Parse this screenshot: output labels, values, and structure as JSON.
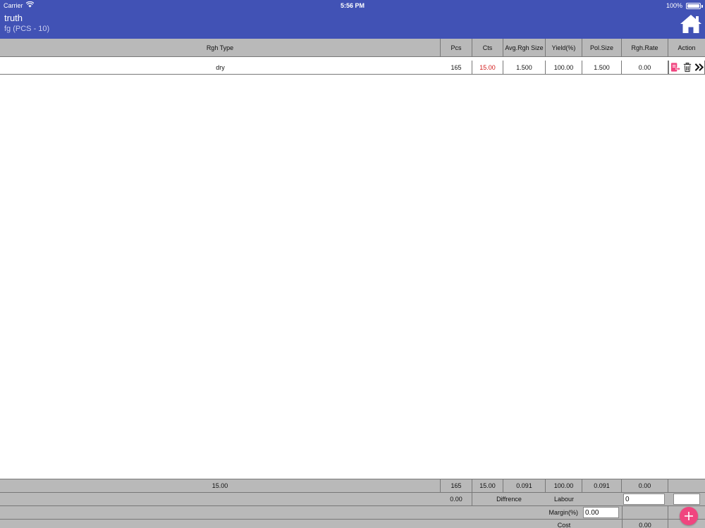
{
  "status_bar": {
    "carrier": "Carrier",
    "time": "5:56 PM",
    "battery": "100%"
  },
  "header": {
    "title": "truth",
    "subtitle": "fg (PCS - 10)"
  },
  "columns": [
    "Rgh Type",
    "Pcs",
    "Cts",
    "Avg.Rgh Size",
    "Yield(%)",
    "Pol.Size",
    "Rgh.Rate",
    "Action"
  ],
  "rows": [
    {
      "rgh_type": "dry",
      "pcs": "165",
      "cts": "15.00",
      "avg_rgh_size": "1.500",
      "yield": "100.00",
      "pol_size": "1.500",
      "rgh_rate": "0.00"
    }
  ],
  "totals": {
    "rgh_type": "15.00",
    "pcs": "165",
    "cts": "15.00",
    "avg_rgh_size": "0.091",
    "yield": "100.00",
    "pol_size": "0.091",
    "rgh_rate": "0.00"
  },
  "summary": {
    "difference_value": "0.00",
    "difference_label": "Diffrence",
    "labour_label": "Labour",
    "labour_value": "0",
    "margin_label": "Margin(%)",
    "margin_value": "0.00",
    "cost_label": "Cost",
    "cost_value": "0.00"
  },
  "colors": {
    "header": "#4152b5",
    "grid": "#b9b9b9",
    "accent": "#f0457f",
    "cts_text": "#d21a1a"
  },
  "icons": [
    "home-icon",
    "edit-export-icon",
    "trash-icon",
    "double-chevron-right-icon",
    "add-icon"
  ]
}
